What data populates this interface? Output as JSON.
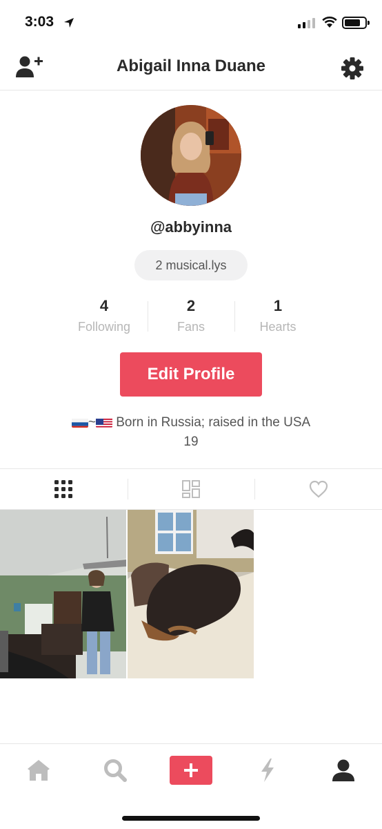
{
  "status_bar": {
    "time": "3:03"
  },
  "header": {
    "title": "Abigail Inna Duane",
    "left_icon": "add-user-icon",
    "right_icon": "gear-icon"
  },
  "profile": {
    "handle": "@abbyinna",
    "musicals": "2 musical.lys",
    "stats": [
      {
        "value": "4",
        "label": "Following"
      },
      {
        "value": "2",
        "label": "Fans"
      },
      {
        "value": "1",
        "label": "Hearts"
      }
    ],
    "edit_button": "Edit Profile",
    "bio_line1_sep": "~",
    "bio_line1_text": "Born in Russia; raised in the USA",
    "bio_line2": "19"
  },
  "tabs": [
    {
      "icon": "grid-icon",
      "active": true
    },
    {
      "icon": "layout-icon",
      "active": false
    },
    {
      "icon": "heart-icon",
      "active": false
    }
  ],
  "bottom_nav": [
    {
      "icon": "home-icon"
    },
    {
      "icon": "search-icon"
    },
    {
      "icon": "plus-icon"
    },
    {
      "icon": "lightning-icon"
    },
    {
      "icon": "profile-icon"
    }
  ],
  "colors": {
    "accent": "#ec4b5d",
    "muted_text": "#b6b6b6",
    "dark_text": "#2a2a2a"
  }
}
